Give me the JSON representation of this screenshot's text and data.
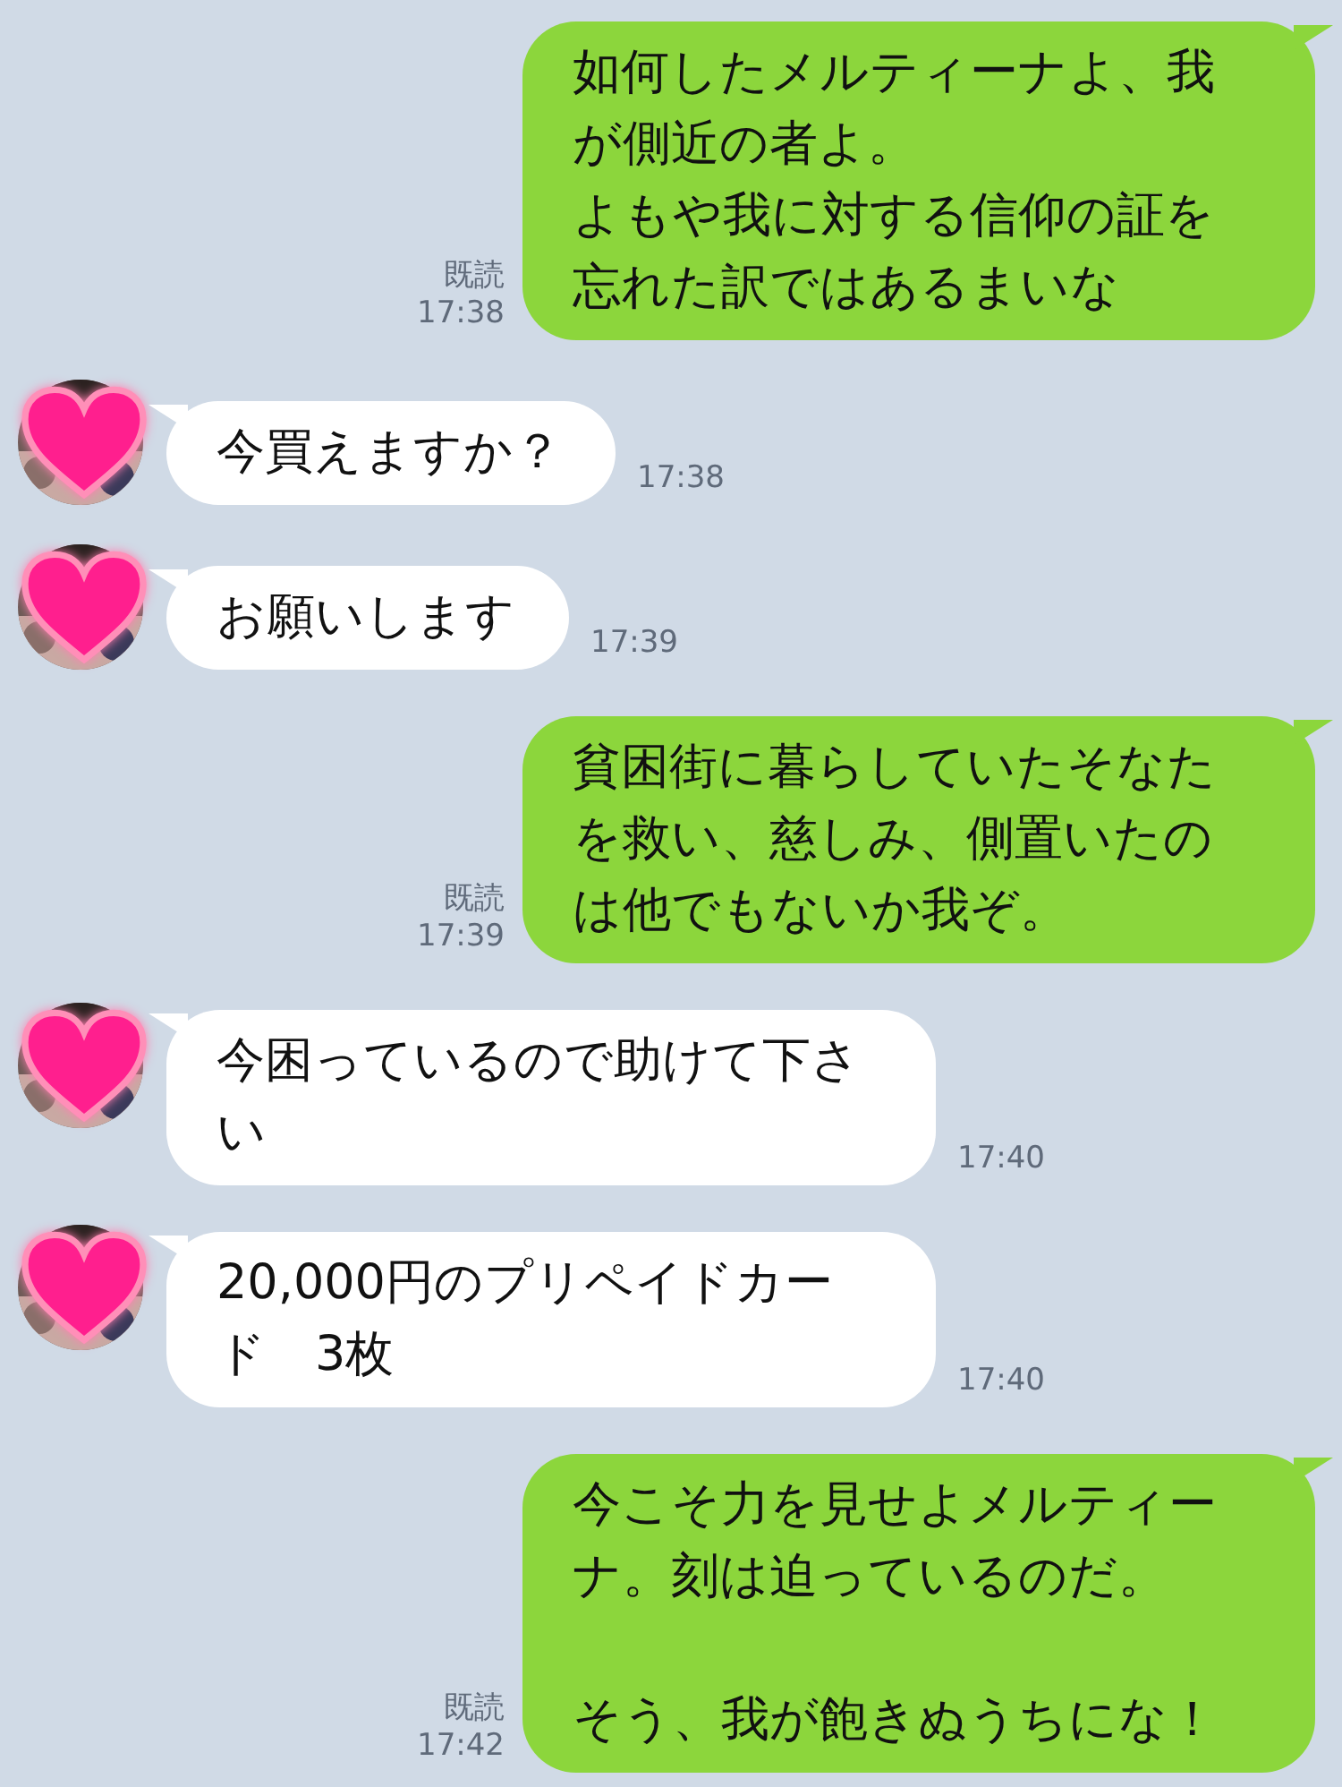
{
  "messages": [
    {
      "kind": "sent",
      "paragraphs": [
        "如何したメルティーナよ、我が側近の者よ。",
        "よもや我に対する信仰の証を忘れた訳ではあるまいな"
      ],
      "read": "既読",
      "time": "17:38"
    },
    {
      "kind": "received",
      "paragraphs": [
        "今買えますか？"
      ],
      "time": "17:38"
    },
    {
      "kind": "received",
      "paragraphs": [
        "お願いします"
      ],
      "time": "17:39"
    },
    {
      "kind": "sent",
      "paragraphs": [
        "貧困街に暮らしていたそなたを救い、慈しみ、側置いたのは他でもないか我ぞ。"
      ],
      "read": "既読",
      "time": "17:39"
    },
    {
      "kind": "received",
      "paragraphs": [
        "今困っているので助けて下さい"
      ],
      "time": "17:40"
    },
    {
      "kind": "received",
      "paragraphs": [
        "20,000円のプリペイドカード　3枚"
      ],
      "time": "17:40"
    },
    {
      "kind": "sent",
      "paragraphs": [
        "今こそ力を見せよメルティーナ。刻は迫っているのだ。",
        "そう、我が飽きぬうちにな！"
      ],
      "spaced": true,
      "read": "既読",
      "time": "17:42"
    }
  ]
}
